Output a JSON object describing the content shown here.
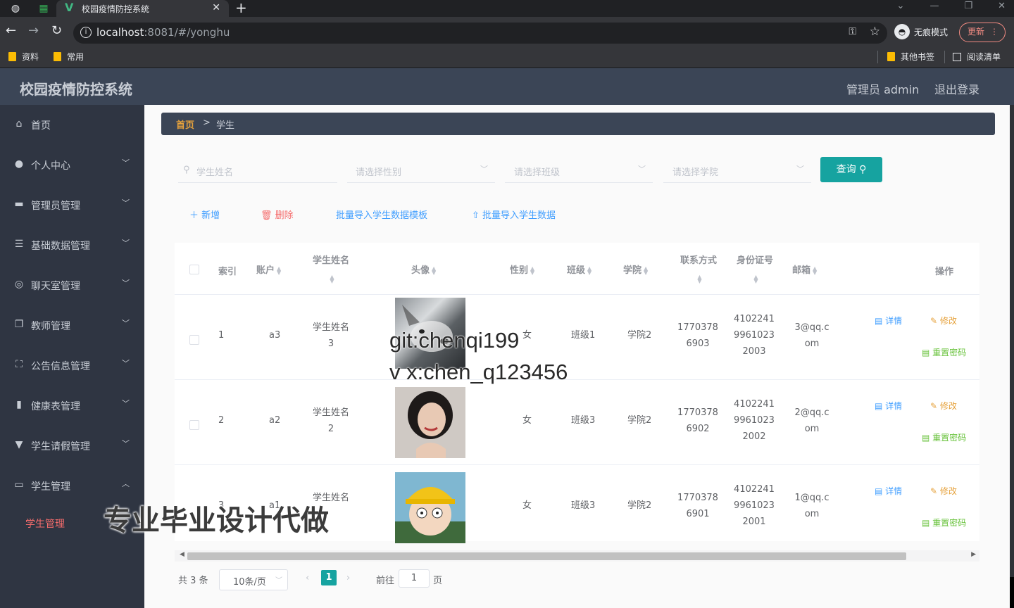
{
  "browser": {
    "tab_title": "校园疫情防控系统",
    "url_host": "localhost",
    "url_rest": ":8081/#/yonghu",
    "incognito_label": "无痕模式",
    "update_label": "更新",
    "bookmarks": [
      "资料",
      "常用"
    ],
    "other_bookmarks": "其他书签",
    "reading_list": "阅读清单"
  },
  "header": {
    "title": "校园疫情防控系统",
    "admin": "管理员 admin",
    "logout": "退出登录"
  },
  "sidebar": {
    "items": [
      {
        "label": "首页",
        "icon": "home-icon"
      },
      {
        "label": "个人中心",
        "icon": "user-icon"
      },
      {
        "label": "管理员管理",
        "icon": "monitor-icon"
      },
      {
        "label": "基础数据管理",
        "icon": "list-icon"
      },
      {
        "label": "聊天室管理",
        "icon": "chat-icon"
      },
      {
        "label": "教师管理",
        "icon": "copy-icon"
      },
      {
        "label": "公告信息管理",
        "icon": "fullscreen-icon"
      },
      {
        "label": "健康表管理",
        "icon": "bar-chart-icon"
      },
      {
        "label": "学生请假管理",
        "icon": "thumb-icon"
      },
      {
        "label": "学生管理",
        "icon": "card-icon"
      }
    ],
    "active_sub": "学生管理"
  },
  "breadcrumb": {
    "home": "首页",
    "sep": ">",
    "current": "学生"
  },
  "search": {
    "name_placeholder": "学生姓名",
    "gender_placeholder": "请选择性别",
    "class_placeholder": "请选择班级",
    "college_placeholder": "请选择学院",
    "query_label": "查询"
  },
  "actions": {
    "add": "新增",
    "delete": "删除",
    "template": "批量导入学生数据模板",
    "import": "批量导入学生数据"
  },
  "table": {
    "headers": {
      "index": "索引",
      "account": "账户",
      "name": "学生姓名",
      "avatar": "头像",
      "gender": "性别",
      "class": "班级",
      "college": "学院",
      "phone": "联系方式",
      "idcard": "身份证号",
      "email": "邮箱",
      "ops": "操作"
    },
    "rows": [
      {
        "index": "1",
        "account": "a3",
        "name1": "学生姓名",
        "name2": "3",
        "gender": "女",
        "class": "班级1",
        "college": "学院2",
        "phone1": "1770378",
        "phone2": "6903",
        "id1": "4102241",
        "id2": "9961023",
        "id3": "2003",
        "email1": "3@qq.c",
        "email2": "om"
      },
      {
        "index": "2",
        "account": "a2",
        "name1": "学生姓名",
        "name2": "2",
        "gender": "女",
        "class": "班级3",
        "college": "学院2",
        "phone1": "1770378",
        "phone2": "6902",
        "id1": "4102241",
        "id2": "9961023",
        "id3": "2002",
        "email1": "2@qq.c",
        "email2": "om"
      },
      {
        "index": "3",
        "account": "a1",
        "name1": "学生姓名",
        "name2": "",
        "gender": "女",
        "class": "班级3",
        "college": "学院2",
        "phone1": "1770378",
        "phone2": "6901",
        "id1": "4102241",
        "id2": "9961023",
        "id3": "2001",
        "email1": "1@qq.c",
        "email2": "om"
      }
    ],
    "op_detail": "详情",
    "op_edit": "修改",
    "op_reset": "重置密码"
  },
  "pagination": {
    "total": "共 3 条",
    "page_size": "10条/页",
    "current": "1",
    "goto": "前往",
    "goto_value": "1",
    "page_suffix": "页"
  },
  "watermark": {
    "line1": "git:chenqi199",
    "line2": "v x:chen_q123456",
    "line3": "专业毕业设计代做"
  },
  "colors": {
    "accent": "#16a3a0",
    "sidebar_bg": "#2f3542",
    "header_bg": "#3b4556",
    "active_red": "#f56c6c"
  }
}
